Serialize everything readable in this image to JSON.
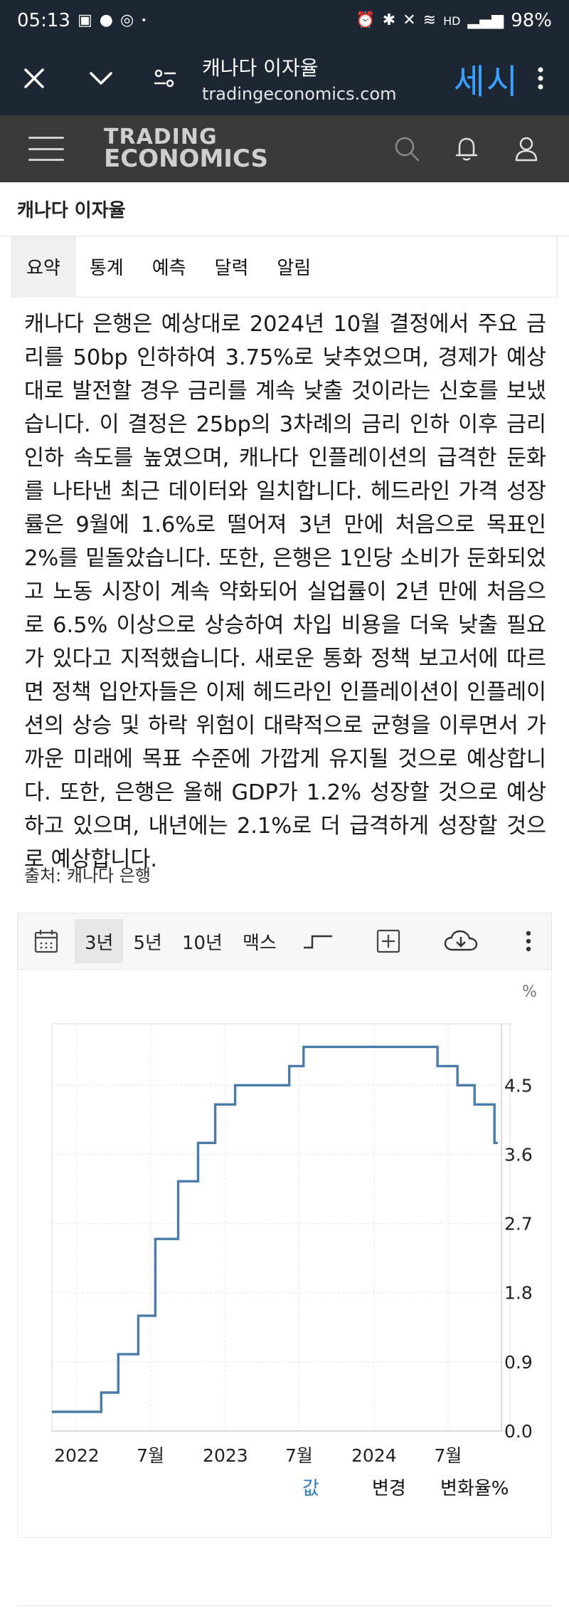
{
  "status_bar": {
    "time": "05:13",
    "battery": "98%",
    "network": "HD"
  },
  "browser": {
    "page_title": "캐나다 이자율",
    "url": "tradingeconomics.com",
    "brand": "세시"
  },
  "site": {
    "logo_line1": "TRADING",
    "logo_line2": "ECONOMICS"
  },
  "page": {
    "title": "캐나다 이자율"
  },
  "tabs": [
    {
      "label": "요약"
    },
    {
      "label": "통계"
    },
    {
      "label": "예측"
    },
    {
      "label": "달력"
    },
    {
      "label": "알림"
    }
  ],
  "summary": {
    "text": "캐나다 은행은 예상대로 2024년 10월 결정에서 주요 금리를 50bp 인하하여 3.75%로 낮추었으며, 경제가 예상대로 발전할 경우 금리를 계속 낮출 것이라는 신호를 보냈습니다. 이 결정은 25bp의 3차례의 금리 인하 이후 금리 인하 속도를 높였으며, 캐나다 인플레이션의 급격한 둔화를 나타낸 최근 데이터와 일치합니다. 헤드라인 가격 성장률은 9월에 1.6%로 떨어져 3년 만에 처음으로 목표인 2%를 밑돌았습니다. 또한, 은행은 1인당 소비가 둔화되었고 노동 시장이 계속 약화되어 실업률이 2년 만에 처음으로 6.5% 이상으로 상승하여 차입 비용을 더욱 낮출 필요가 있다고 지적했습니다. 새로운 통화 정책 보고서에 따르면 정책 입안자들은 이제 헤드라인 인플레이션이 인플레이션의 상승 및 하락 위험이 대략적으로 균형을 이루면서 가까운 미래에 목표 수준에 가깝게 유지될 것으로 예상합니다. 또한, 은행은 올해 GDP가 1.2% 성장할 것으로 예상하고 있으며, 내년에는 2.1%로 더 급격하게 성장할 것으로 예상합니다.",
    "source": "출처: 캐나다 은행"
  },
  "chart_toolbar": {
    "ranges": [
      {
        "label": "3년",
        "active": true
      },
      {
        "label": "5년",
        "active": false
      },
      {
        "label": "10년",
        "active": false
      },
      {
        "label": "맥스",
        "active": false
      }
    ],
    "icons": [
      "calendar-icon",
      "step-chart-icon",
      "compare-add-icon",
      "download-icon",
      "more-icon"
    ]
  },
  "chart_data": {
    "type": "line",
    "line_style": "step",
    "unit_label": "%",
    "color": "#4a7bab",
    "x_tick_labels": [
      "2022",
      "7월",
      "2023",
      "7월",
      "2024",
      "7월"
    ],
    "x_tick_dates": [
      "2022-01-01",
      "2022-07-01",
      "2023-01-01",
      "2023-07-01",
      "2024-01-01",
      "2024-07-01"
    ],
    "y_ticks": [
      0.0,
      0.9,
      1.8,
      2.7,
      3.6,
      4.5
    ],
    "y_tick_labels": [
      "0.0",
      "0.9",
      "1.8",
      "2.7",
      "3.6",
      "4.5"
    ],
    "ylim": [
      0,
      5.3
    ],
    "xlim": [
      "2021-11-01",
      "2024-11-30"
    ],
    "grid": true,
    "points": [
      {
        "date": "2021-11-01",
        "value": 0.25
      },
      {
        "date": "2022-03-02",
        "value": 0.5
      },
      {
        "date": "2022-04-13",
        "value": 1.0
      },
      {
        "date": "2022-06-01",
        "value": 1.5
      },
      {
        "date": "2022-07-13",
        "value": 2.5
      },
      {
        "date": "2022-09-07",
        "value": 3.25
      },
      {
        "date": "2022-10-26",
        "value": 3.75
      },
      {
        "date": "2022-12-07",
        "value": 4.25
      },
      {
        "date": "2023-01-25",
        "value": 4.5
      },
      {
        "date": "2023-06-07",
        "value": 4.75
      },
      {
        "date": "2023-07-12",
        "value": 5.0
      },
      {
        "date": "2024-06-05",
        "value": 4.75
      },
      {
        "date": "2024-07-24",
        "value": 4.5
      },
      {
        "date": "2024-09-04",
        "value": 4.25
      },
      {
        "date": "2024-10-23",
        "value": 3.75
      },
      {
        "date": "2024-10-31",
        "value": 3.75
      }
    ]
  },
  "legend": {
    "items": [
      {
        "label": "값",
        "active": true
      },
      {
        "label": "변경",
        "active": false
      },
      {
        "label": "변화율%",
        "active": false
      }
    ]
  }
}
